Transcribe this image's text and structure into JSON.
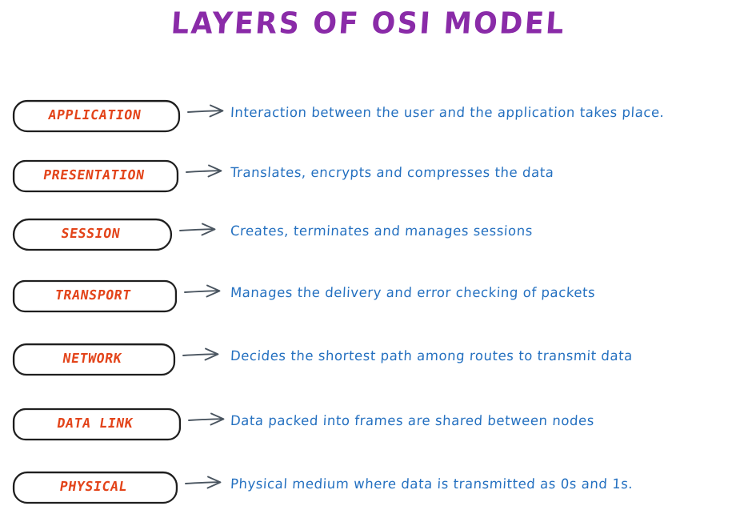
{
  "title": "LAYERS OF OSI MODEL",
  "colors": {
    "title": "#8A2BA8",
    "layer_name": "#E3441A",
    "description": "#2470C0",
    "box_stroke": "#1A1A1A",
    "arrow": "#4A5560",
    "background": "#FFFFFF"
  },
  "arrow_icon": "right-arrow-icon",
  "layers": [
    {
      "name": "APPLICATION",
      "description": "Interaction between the user and the application takes place."
    },
    {
      "name": "PRESENTATION",
      "description": "Translates, encrypts and compresses the data"
    },
    {
      "name": "SESSION",
      "description": "Creates, terminates and manages sessions"
    },
    {
      "name": "TRANSPORT",
      "description": "Manages the delivery and error checking of packets"
    },
    {
      "name": "NETWORK",
      "description": "Decides the shortest path among routes to transmit data"
    },
    {
      "name": "DATA LINK",
      "description": "Data packed into frames are shared between nodes"
    },
    {
      "name": "PHYSICAL",
      "description": "Physical medium where data is transmitted as 0s and 1s."
    }
  ]
}
